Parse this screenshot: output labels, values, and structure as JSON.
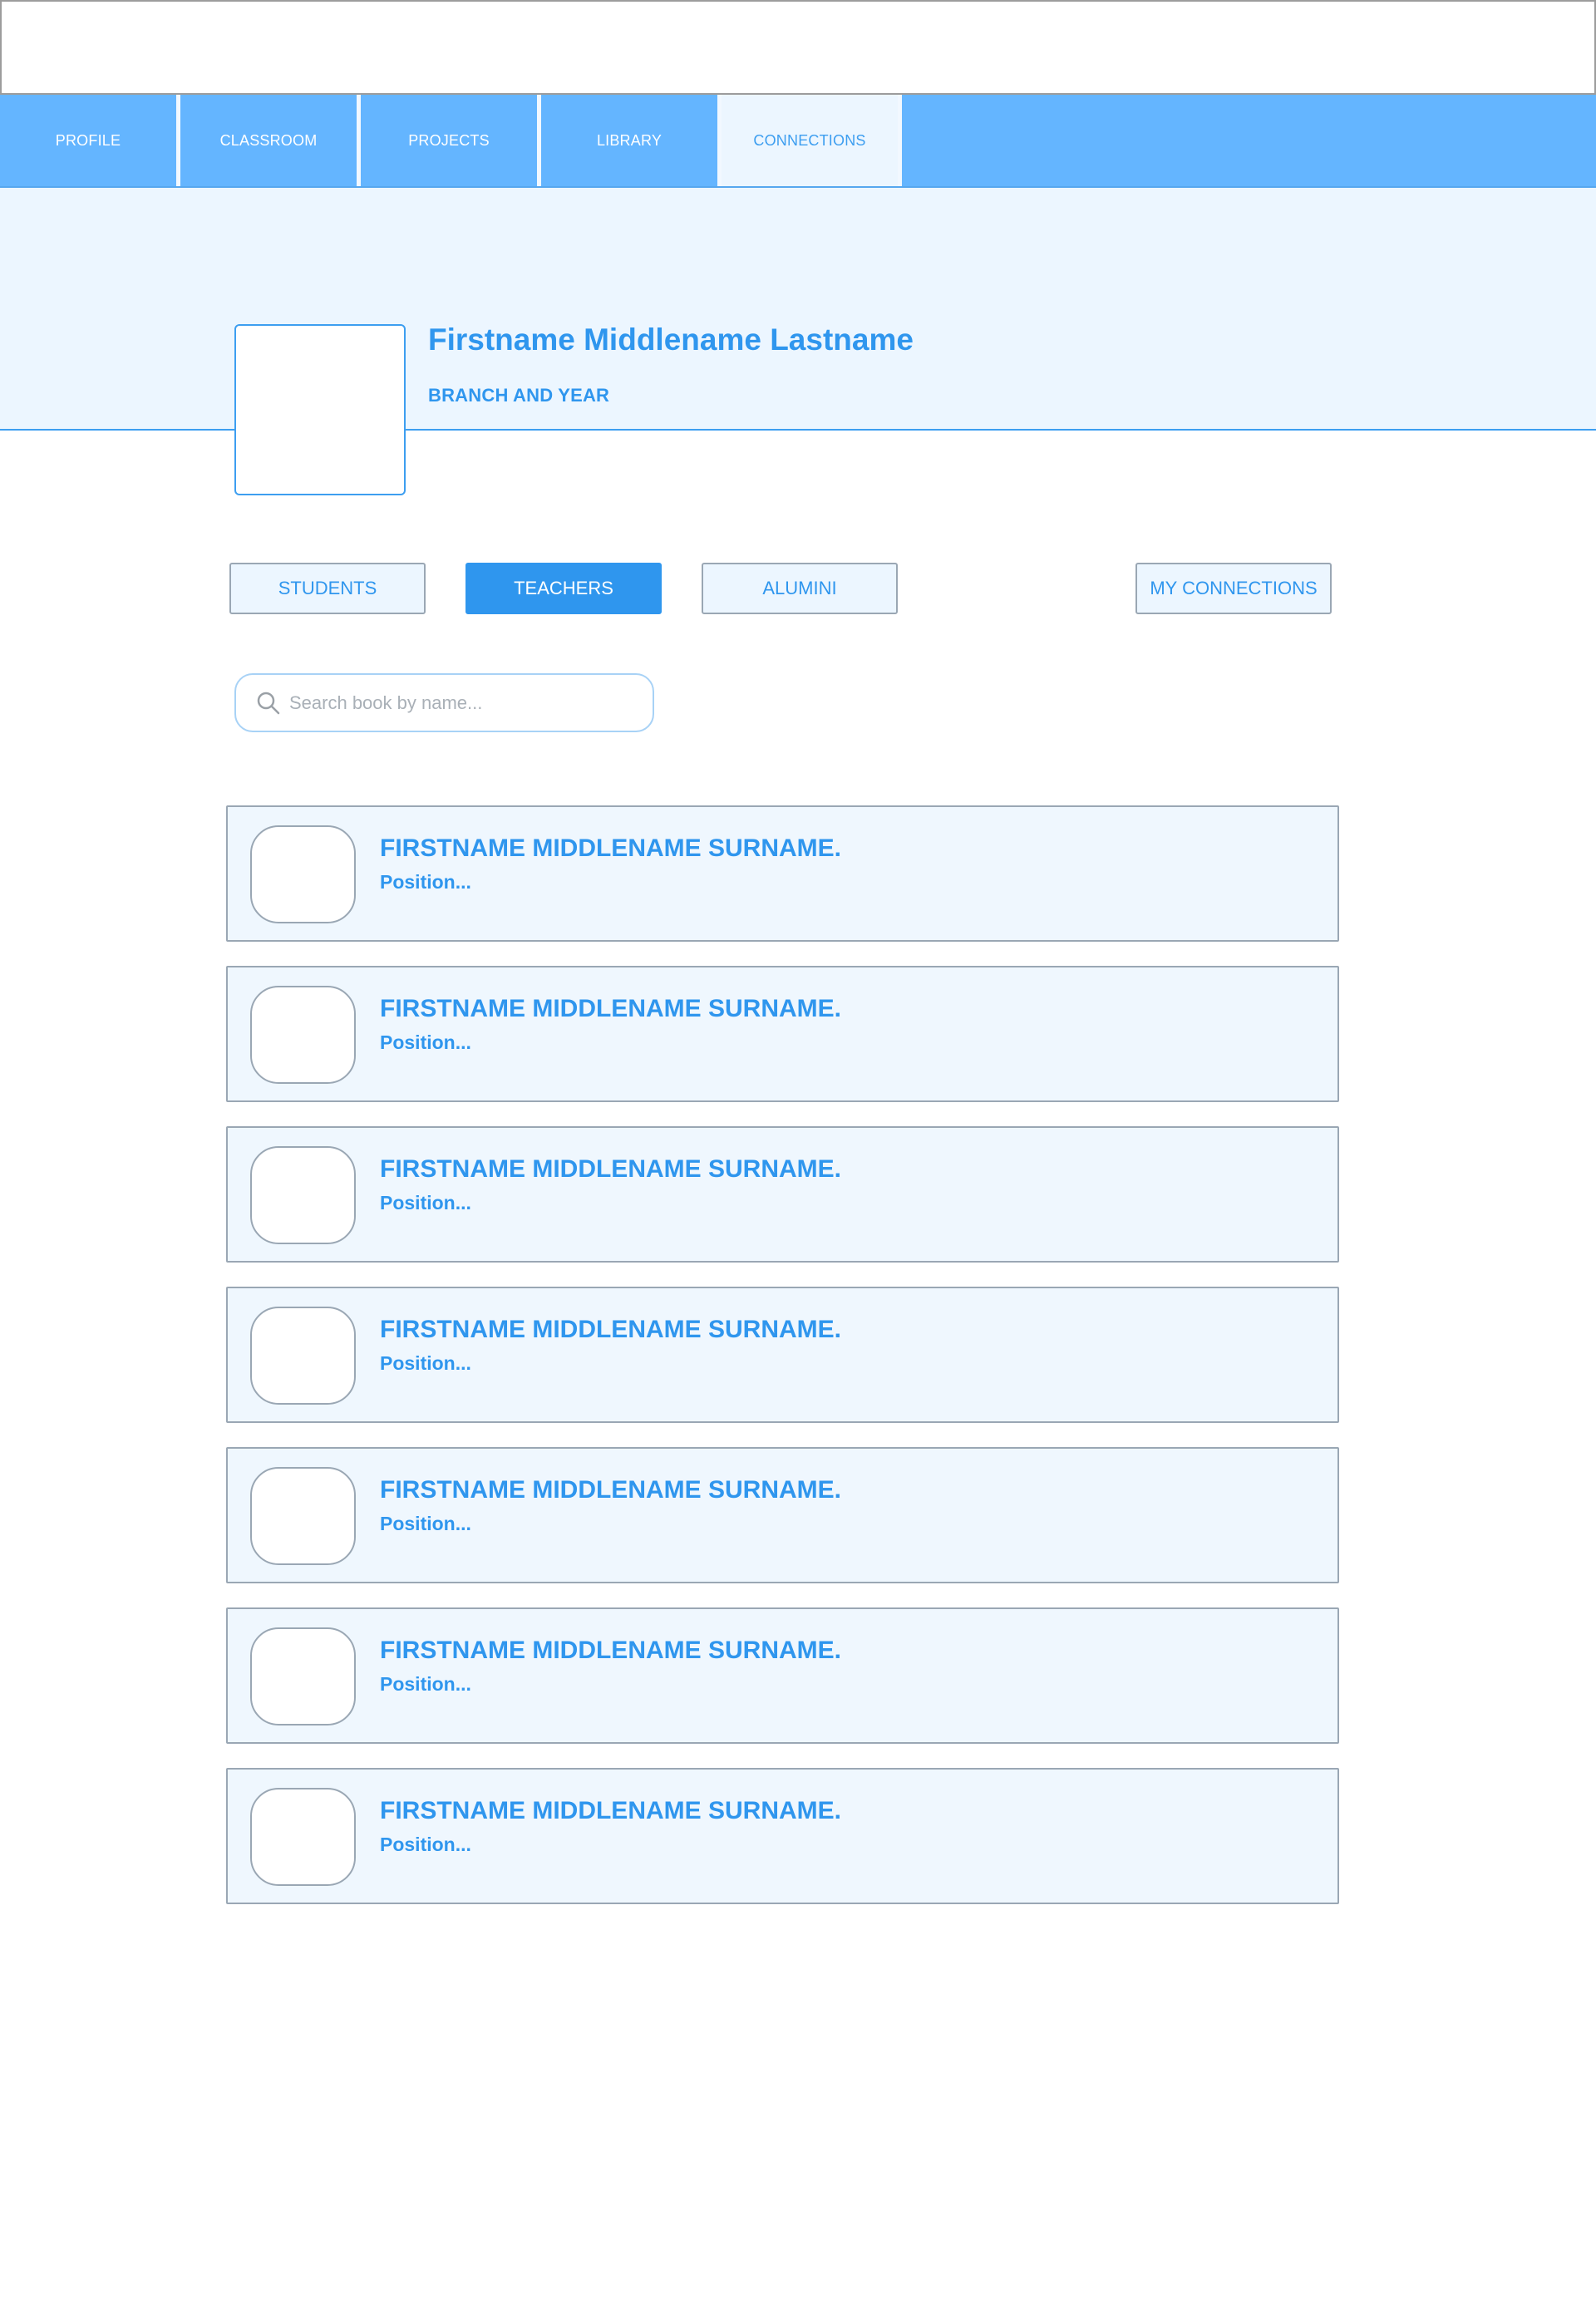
{
  "nav": {
    "tabs": [
      {
        "label": "PROFILE"
      },
      {
        "label": "CLASSROOM"
      },
      {
        "label": "PROJECTS"
      },
      {
        "label": "LIBRARY"
      },
      {
        "label": "CONNECTIONS"
      }
    ],
    "active_tab": "CONNECTIONS"
  },
  "profile": {
    "name": "Firstname Middlename Lastname",
    "subtitle": "BRANCH AND YEAR"
  },
  "filters": {
    "students": "STUDENTS",
    "teachers": "TEACHERS",
    "alumni": "ALUMINI",
    "my_connections": "MY CONNECTIONS",
    "active": "TEACHERS"
  },
  "search": {
    "placeholder": "Search book by name...",
    "value": ""
  },
  "connections": [
    {
      "name": "FIRSTNAME MIDDLENAME SURNAME.",
      "position": "Position..."
    },
    {
      "name": "FIRSTNAME MIDDLENAME SURNAME.",
      "position": "Position..."
    },
    {
      "name": "FIRSTNAME MIDDLENAME SURNAME.",
      "position": "Position..."
    },
    {
      "name": "FIRSTNAME MIDDLENAME SURNAME.",
      "position": "Position..."
    },
    {
      "name": "FIRSTNAME MIDDLENAME SURNAME.",
      "position": "Position..."
    },
    {
      "name": "FIRSTNAME MIDDLENAME SURNAME.",
      "position": "Position..."
    },
    {
      "name": "FIRSTNAME MIDDLENAME SURNAME.",
      "position": "Position..."
    }
  ],
  "colors": {
    "nav_bg": "#64b5ff",
    "accent": "#2f96ee",
    "hero_bg": "#ecf6ff",
    "card_bg": "#eff7fe",
    "border": "#9aa7b4"
  }
}
